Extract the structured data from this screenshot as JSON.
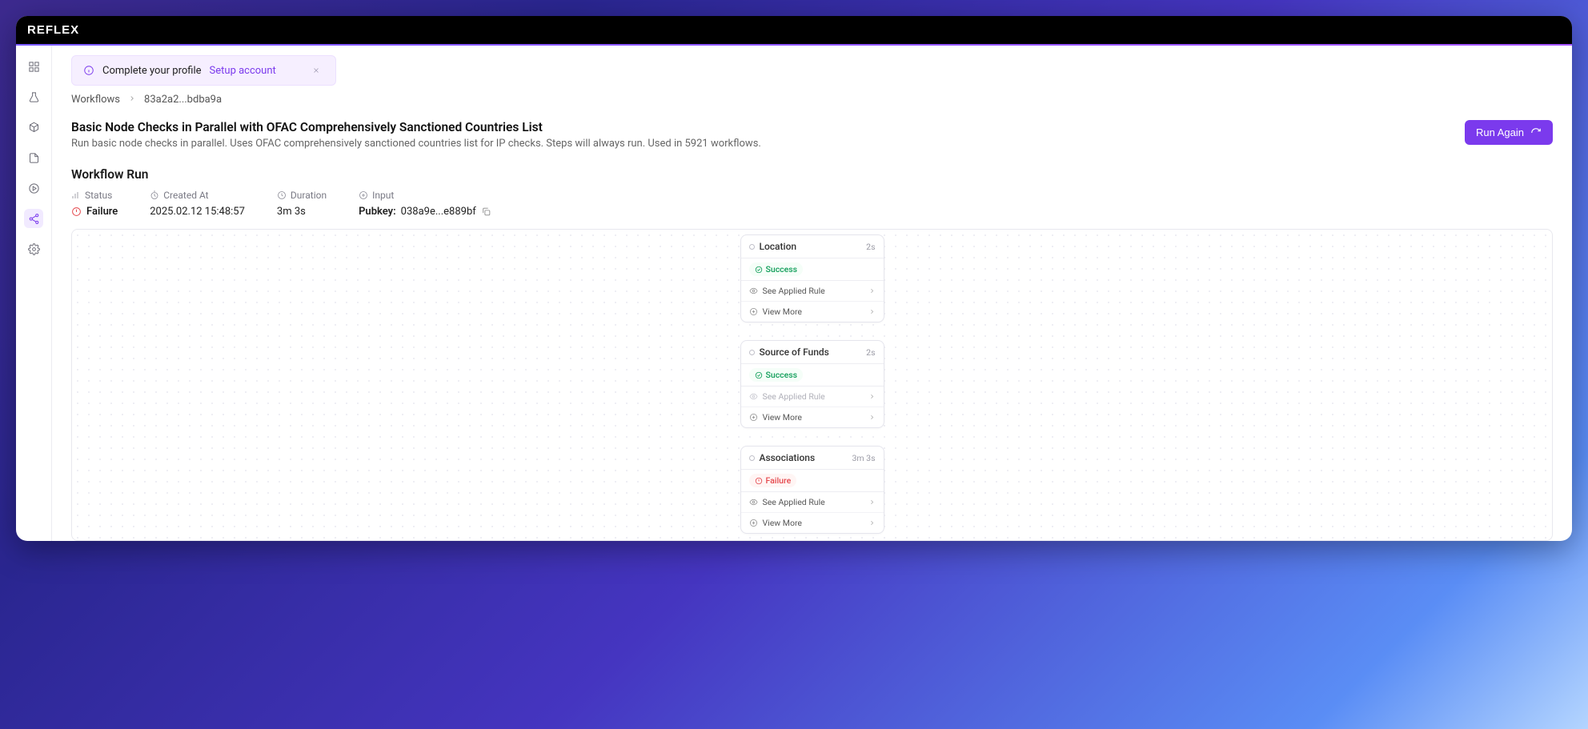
{
  "brand": "REFLEX",
  "banner": {
    "text": "Complete your profile",
    "action": "Setup account"
  },
  "breadcrumbs": {
    "root": "Workflows",
    "id": "83a2a2...bdba9a"
  },
  "header": {
    "title": "Basic Node Checks in Parallel with OFAC Comprehensively Sanctioned Countries List",
    "description": "Run basic node checks in parallel. Uses OFAC comprehensively sanctioned countries list for IP checks. Steps will always run. Used in 5921 workflows.",
    "run_again": "Run Again"
  },
  "section": {
    "title": "Workflow Run"
  },
  "meta": {
    "status_label": "Status",
    "status_value": "Failure",
    "created_label": "Created At",
    "created_value": "2025.02.12 15:48:57",
    "duration_label": "Duration",
    "duration_value": "3m 3s",
    "input_label": "Input",
    "input_key": "Pubkey:",
    "input_value": "038a9e...e889bf"
  },
  "nodes": [
    {
      "title": "Location",
      "time": "2s",
      "status": "Success",
      "status_kind": "success",
      "rule_label": "See Applied Rule",
      "rule_muted": false,
      "more_label": "View More"
    },
    {
      "title": "Source of Funds",
      "time": "2s",
      "status": "Success",
      "status_kind": "success",
      "rule_label": "See Applied Rule",
      "rule_muted": true,
      "more_label": "View More"
    },
    {
      "title": "Associations",
      "time": "3m 3s",
      "status": "Failure",
      "status_kind": "failure",
      "rule_label": "See Applied Rule",
      "rule_muted": false,
      "more_label": "View More"
    }
  ]
}
